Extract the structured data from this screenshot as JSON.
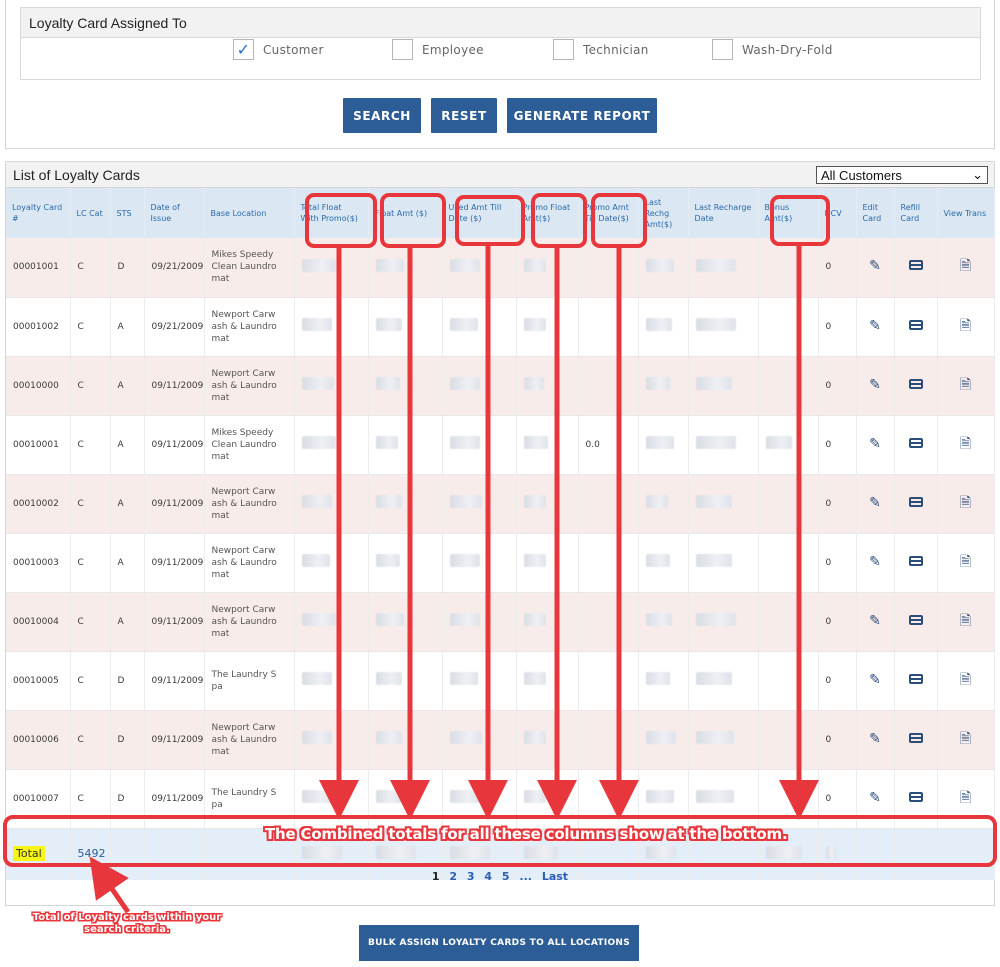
{
  "filter": {
    "heading": "Loyalty Card Assigned To",
    "options": [
      {
        "label": "Customer",
        "checked": true
      },
      {
        "label": "Employee",
        "checked": false
      },
      {
        "label": "Technician",
        "checked": false
      },
      {
        "label": "Wash-Dry-Fold",
        "checked": false
      }
    ],
    "buttons": {
      "search": "SEARCH",
      "reset": "RESET",
      "report": "GENERATE REPORT"
    }
  },
  "list": {
    "heading": "List of Loyalty Cards",
    "dropdown_value": "All Customers",
    "columns": [
      "Loyalty Card #",
      "LC Cat",
      "STS",
      "Date of Issue",
      "Base Location",
      "Total Float With Promo($)",
      "Float Amt ($)",
      "Used Amt Till Date ($)",
      "Promo Float Amt($)",
      "Promo Amt Till Date($)",
      "Last Rechg Amt($)",
      "Last Recharge Date",
      "Bonus Amt($)",
      "DCV",
      "Edit Card",
      "Refill Card",
      "View Trans"
    ],
    "rows": [
      {
        "card": "00001001",
        "cat": "C",
        "sts": "D",
        "date": "09/21/2009",
        "location": "Mikes Speedy Clean Laundro mat",
        "promo_till": "",
        "dcv": "0"
      },
      {
        "card": "00001002",
        "cat": "C",
        "sts": "A",
        "date": "09/21/2009",
        "location": "Newport Carw ash & Laundro mat",
        "promo_till": "",
        "dcv": "0"
      },
      {
        "card": "00010000",
        "cat": "C",
        "sts": "A",
        "date": "09/11/2009",
        "location": "Newport Carw ash & Laundro mat",
        "promo_till": "",
        "dcv": "0"
      },
      {
        "card": "00010001",
        "cat": "C",
        "sts": "A",
        "date": "09/11/2009",
        "location": "Mikes Speedy Clean Laundro mat",
        "promo_till": "0.0",
        "dcv": "0"
      },
      {
        "card": "00010002",
        "cat": "C",
        "sts": "A",
        "date": "09/11/2009",
        "location": "Newport Carw ash & Laundro mat",
        "promo_till": "",
        "dcv": "0"
      },
      {
        "card": "00010003",
        "cat": "C",
        "sts": "A",
        "date": "09/11/2009",
        "location": "Newport Carw ash & Laundro mat",
        "promo_till": "",
        "dcv": "0"
      },
      {
        "card": "00010004",
        "cat": "C",
        "sts": "A",
        "date": "09/11/2009",
        "location": "Newport Carw ash & Laundro mat",
        "promo_till": "",
        "dcv": "0"
      },
      {
        "card": "00010005",
        "cat": "C",
        "sts": "D",
        "date": "09/11/2009",
        "location": "The Laundry S pa",
        "promo_till": "",
        "dcv": "0"
      },
      {
        "card": "00010006",
        "cat": "C",
        "sts": "D",
        "date": "09/11/2009",
        "location": "Newport Carw ash & Laundro mat",
        "promo_till": "",
        "dcv": "0"
      },
      {
        "card": "00010007",
        "cat": "C",
        "sts": "D",
        "date": "09/11/2009",
        "location": "The Laundry S pa",
        "promo_till": "",
        "dcv": "0"
      }
    ],
    "total_label": "Total",
    "total_count": "5492",
    "pagination": {
      "pages": [
        "1",
        "2",
        "3",
        "4",
        "5"
      ],
      "ellipsis": "...",
      "last": "Last",
      "current": "1"
    }
  },
  "bulk_button": "BULK ASSIGN LOYALTY CARDS TO ALL LOCATIONS",
  "annotations": {
    "totals_note": "The Combined totals for all these columns show at the bottom.",
    "count_note": "Total of Loyalty cards within your search criteria.",
    "color": "#e8373c"
  },
  "icons": {
    "edit": "edit-icon",
    "refill": "card-icon",
    "view": "document-view-icon"
  },
  "colors": {
    "primary_button": "#2c5d96",
    "header_bg": "#dbe8f3",
    "header_text": "#2b6aa9",
    "odd_row": "#f8eceb",
    "total_highlight": "#f8f518"
  }
}
